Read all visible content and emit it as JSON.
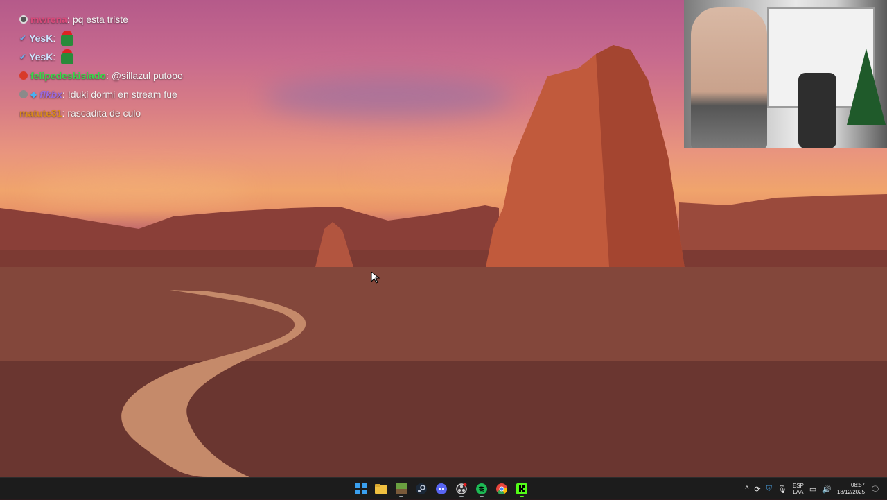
{
  "chat": [
    {
      "badge_color": "#555555",
      "user": "mwrena",
      "user_color": "#d94a7a",
      "text": "pq esta triste",
      "emote": false,
      "verified": false
    },
    {
      "badge_color": "",
      "user": "YesK",
      "user_color": "#cfe3ff",
      "text": "",
      "emote": true,
      "verified": true
    },
    {
      "badge_color": "",
      "user": "YesK",
      "user_color": "#cfe3ff",
      "text": "",
      "emote": true,
      "verified": true
    },
    {
      "badge_color": "#d83a2a",
      "user": "felipedeskisiado",
      "user_color": "#38d84a",
      "text": "@sillazul putooo",
      "emote": false,
      "verified": false
    },
    {
      "badge_color": "#8a8a8a",
      "user": "flkbx",
      "user_color": "#9a6adf",
      "text": "!duki dormi en stream fue",
      "emote": false,
      "verified": false
    },
    {
      "badge_color": "",
      "user": "matute31",
      "user_color": "#d88a1a",
      "text": "rascadita de culo",
      "emote": false,
      "verified": false
    }
  ],
  "taskbar": {
    "apps": [
      {
        "name": "windows-start-icon",
        "color": "#3aa0f0"
      },
      {
        "name": "file-explorer-icon",
        "color": "#f0c040"
      },
      {
        "name": "minecraft-icon",
        "color": "#6aa040"
      },
      {
        "name": "steam-icon",
        "color": "#c8d0e0"
      },
      {
        "name": "discord-icon",
        "color": "#5865f2"
      },
      {
        "name": "obs-icon",
        "color": "#d0d0d0"
      },
      {
        "name": "spotify-icon",
        "color": "#1db954"
      },
      {
        "name": "chrome-icon",
        "color": "#e8453c"
      },
      {
        "name": "kick-icon",
        "color": "#53fc18"
      }
    ],
    "tray": {
      "lang_top": "ESP",
      "lang_bottom": "LAA",
      "time": "08:57",
      "date": "18/12/2025"
    }
  }
}
